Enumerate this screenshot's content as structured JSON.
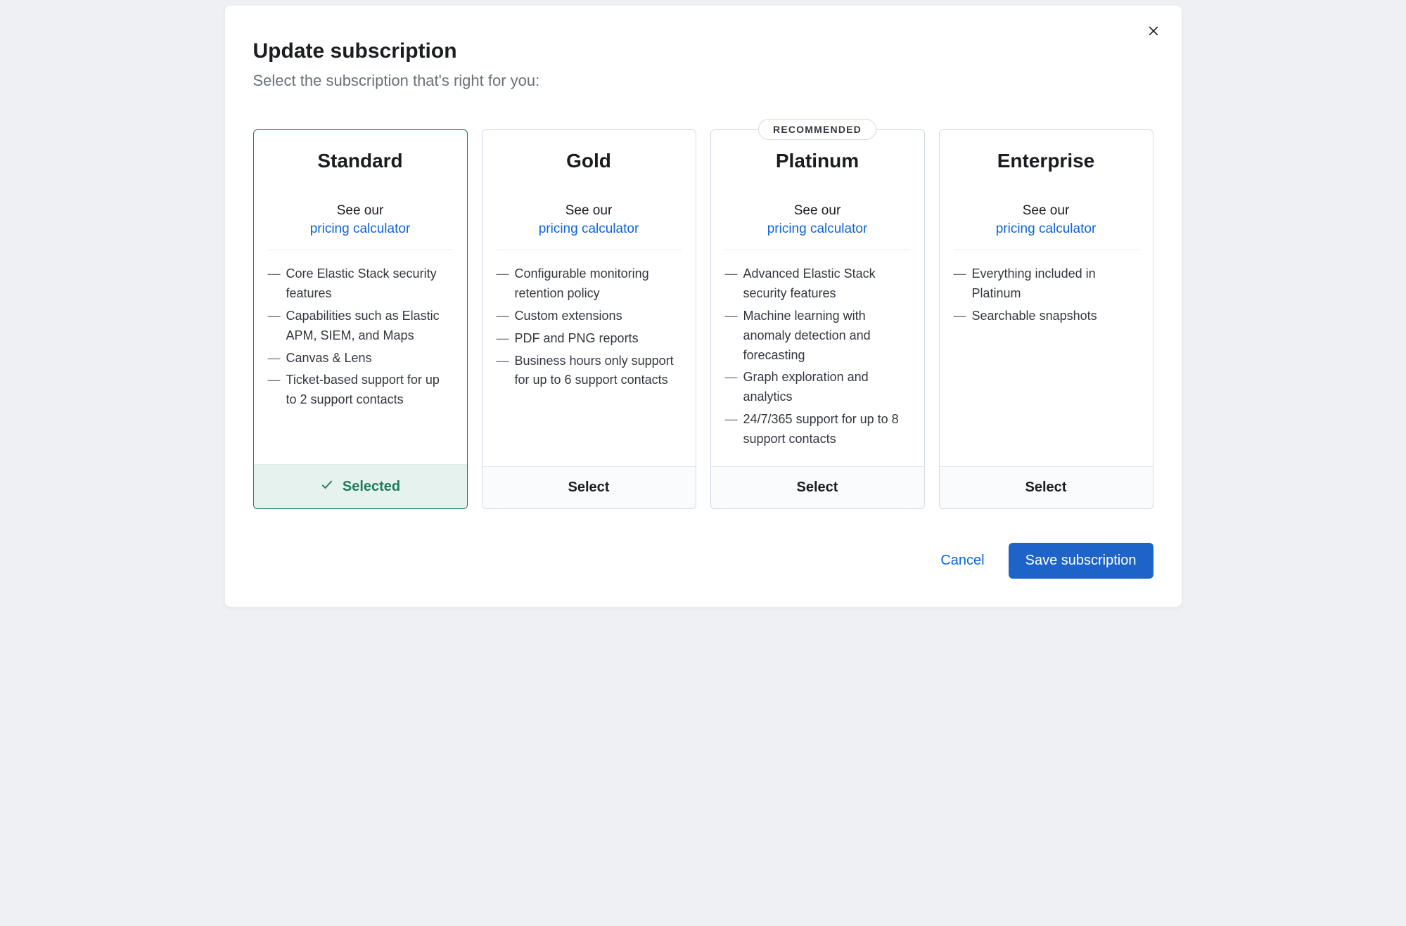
{
  "modal": {
    "title": "Update subscription",
    "subtitle": "Select the subscription that's right for you:",
    "close_icon": "close"
  },
  "common": {
    "see_our": "See our",
    "pricing_link": "pricing calculator",
    "select_label": "Select",
    "selected_label": "Selected",
    "recommended_badge": "RECOMMENDED"
  },
  "plans": [
    {
      "id": "standard",
      "name": "Standard",
      "selected": true,
      "recommended": false,
      "features": [
        "Core Elastic Stack security features",
        "Capabilities such as Elastic APM, SIEM, and Maps",
        "Canvas & Lens",
        "Ticket-based support for up to 2 support contacts"
      ]
    },
    {
      "id": "gold",
      "name": "Gold",
      "selected": false,
      "recommended": false,
      "features": [
        "Configurable monitoring retention policy",
        "Custom extensions",
        "PDF and PNG reports",
        "Business hours only support for up to 6 support contacts"
      ]
    },
    {
      "id": "platinum",
      "name": "Platinum",
      "selected": false,
      "recommended": true,
      "features": [
        "Advanced Elastic Stack security features",
        "Machine learning with anomaly detection and forecasting",
        "Graph exploration and analytics",
        "24/7/365 support for up to 8 support contacts"
      ]
    },
    {
      "id": "enterprise",
      "name": "Enterprise",
      "selected": false,
      "recommended": false,
      "features": [
        "Everything included in Platinum",
        "Searchable snapshots"
      ]
    }
  ],
  "actions": {
    "cancel": "Cancel",
    "save": "Save subscription"
  }
}
